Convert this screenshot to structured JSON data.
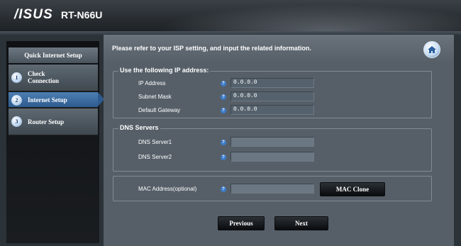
{
  "header": {
    "brand": "/ISUS",
    "model": "RT-N66U"
  },
  "sidebar": {
    "title": "Quick Internet Setup",
    "items": [
      {
        "num": "1",
        "label_line1": "Check",
        "label_line2": "Connection"
      },
      {
        "num": "2",
        "label": "Internet Setup"
      },
      {
        "num": "3",
        "label": "Router Setup"
      }
    ]
  },
  "main": {
    "instruction": "Please refer to your ISP setting, and input the related information.",
    "ip_group": {
      "legend": "Use the following IP address:",
      "ip_label": "IP Address",
      "ip_value": "0.0.0.0",
      "subnet_label": "Subnet Mask",
      "subnet_value": "0.0.0.0",
      "gateway_label": "Default Gateway",
      "gateway_value": "0.0.0.0"
    },
    "dns_group": {
      "legend": "DNS Servers",
      "dns1_label": "DNS Server1",
      "dns1_value": "",
      "dns2_label": "DNS Server2",
      "dns2_value": ""
    },
    "mac_group": {
      "label": "MAC Address(optional)",
      "value": "",
      "clone_button": "MAC Clone"
    },
    "help_glyph": "?",
    "buttons": {
      "previous": "Previous",
      "next": "Next"
    }
  },
  "colors": {
    "accent": "#2e5b8f",
    "panel": "#565f68",
    "sidebar": "#0f1113"
  }
}
